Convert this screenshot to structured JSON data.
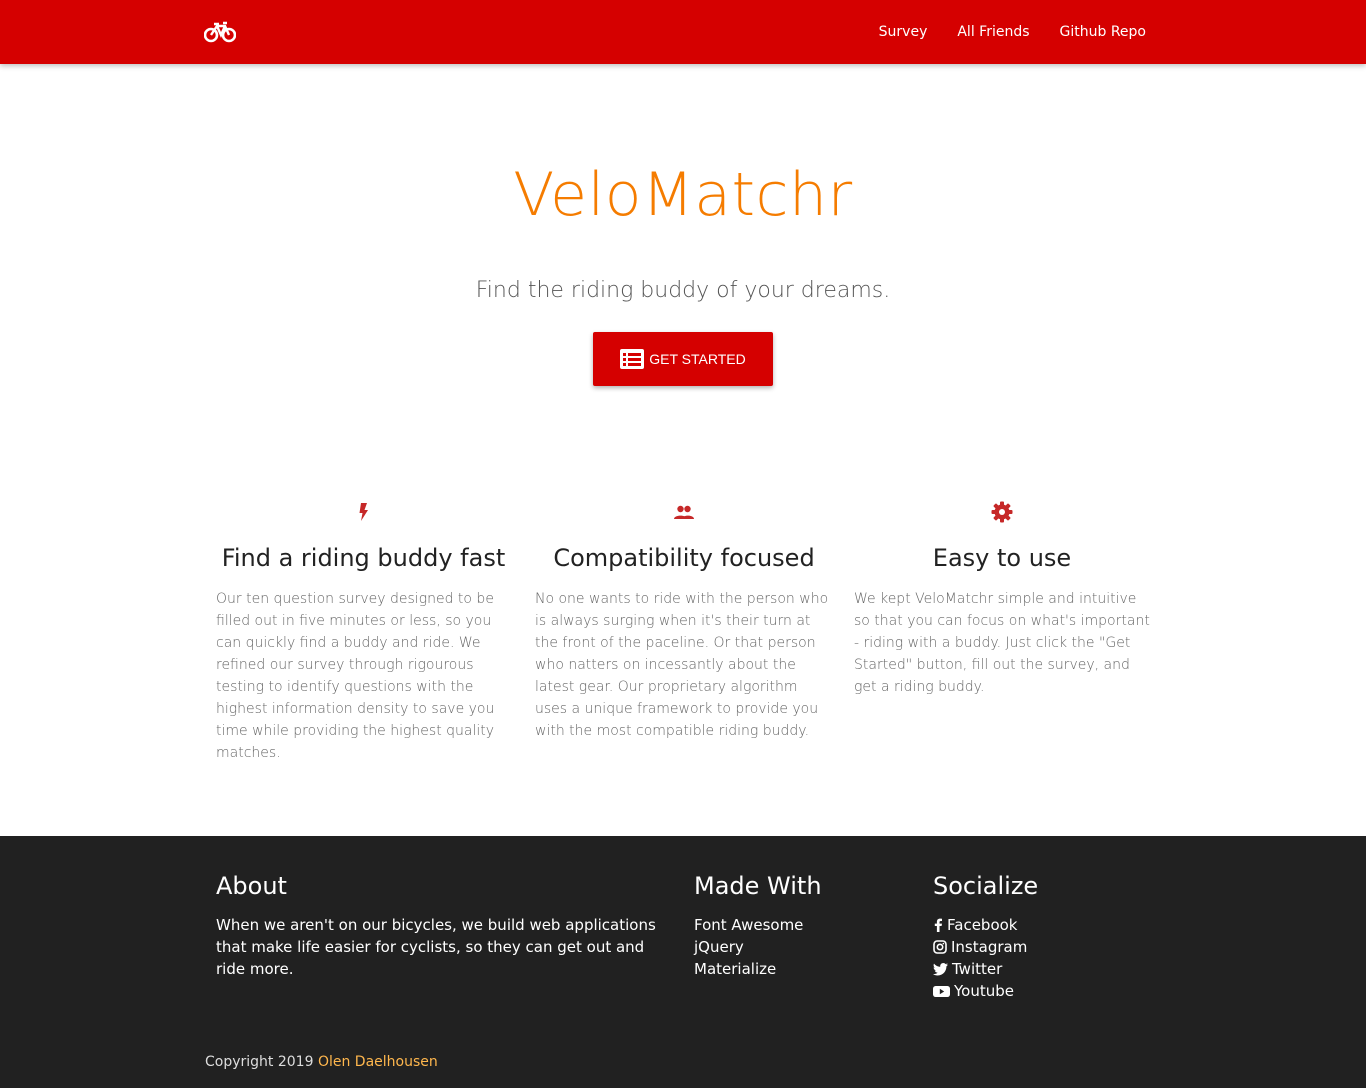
{
  "nav": {
    "brand_icon": "bicycle-icon",
    "links": [
      "Survey",
      "All Friends",
      "Github Repo"
    ]
  },
  "hero": {
    "title": "VeloMatchr",
    "subtitle": "Find the riding buddy of your dreams.",
    "cta_label": "GET STARTED",
    "cta_icon": "list-icon"
  },
  "features": [
    {
      "icon": "bolt-icon",
      "title": "Find a riding buddy fast",
      "text": "Our ten question survey designed to be filled out in five minutes or less, so you can quickly find a buddy and ride. We refined our survey through rigourous testing to identify questions with the highest information density to save you time while providing the highest quality matches."
    },
    {
      "icon": "group-icon",
      "title": "Compatibility focused",
      "text": "No one wants to ride with the person who is always surging when it's their turn at the front of the paceline. Or that person who natters on incessantly about the latest gear. Our proprietary algorithm uses a unique framework to provide you with the most compatible riding buddy."
    },
    {
      "icon": "gear-icon",
      "title": "Easy to use",
      "text": "We kept VeloMatchr simple and intuitive so that you can focus on what's important - riding with a buddy. Just click the \"Get Started\" button, fill out the survey, and get a riding buddy."
    }
  ],
  "footer": {
    "about_title": "About",
    "about_text": "When we aren't on our bicycles, we build web applications that make life easier for cyclists, so they can get out and ride more.",
    "made_title": "Made With",
    "made_items": [
      "Font Awesome",
      "jQuery",
      "Materialize"
    ],
    "social_title": "Socialize",
    "social_items": [
      {
        "icon": "facebook-icon",
        "label": "Facebook"
      },
      {
        "icon": "instagram-icon",
        "label": "Instagram"
      },
      {
        "icon": "twitter-icon",
        "label": "Twitter"
      },
      {
        "icon": "youtube-icon",
        "label": "Youtube"
      }
    ],
    "copyright_prefix": "Copyright 2019",
    "copyright_name": "Olen Daelhousen"
  },
  "colors": {
    "primary": "#d50000",
    "title_orange": "#f57c00",
    "footer_bg": "#212121",
    "link_accent": "#ffb74d",
    "icon_red": "#c62828"
  }
}
